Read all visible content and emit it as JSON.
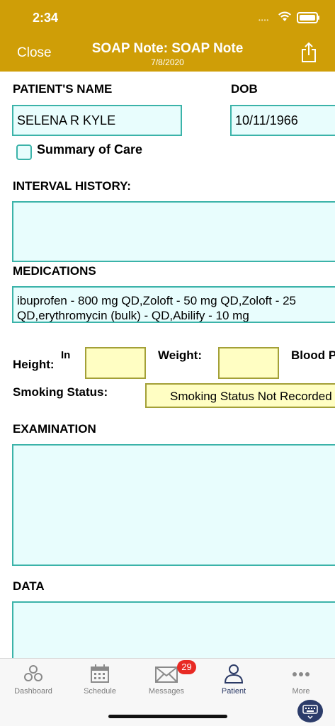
{
  "status_bar": {
    "time": "2:34"
  },
  "header": {
    "close_label": "Close",
    "title": "SOAP Note: SOAP Note",
    "date": "7/8/2020",
    "share_icon": "share-icon"
  },
  "patient": {
    "name_label": "PATIENT'S NAME",
    "name_value": "SELENA R KYLE",
    "dob_label": "DOB",
    "dob_value": "10/11/1966",
    "summary_of_care_label": "Summary of Care",
    "summary_of_care_checked": false
  },
  "interval_history": {
    "label": "INTERVAL HISTORY:",
    "value": ""
  },
  "medications": {
    "label": "MEDICATIONS",
    "line1": "ibuprofen - 800 mg QD,Zoloft - 50 mg QD,Zoloft - 25",
    "line2": "QD,erythromycin (bulk) -  QD,Abilify - 10 mg"
  },
  "vitals": {
    "height_label": "Height:",
    "height_unit": "In",
    "weight_label": "Weight:",
    "blood_label": "Blood P",
    "smoking_label": "Smoking Status:",
    "smoking_value": "Smoking Status Not Recorded"
  },
  "examination": {
    "label": "EXAMINATION",
    "value": ""
  },
  "data_section": {
    "label": "DATA",
    "value": ""
  },
  "tabbar": {
    "tabs": [
      {
        "label": "Dashboard",
        "icon": "dashboard-icon"
      },
      {
        "label": "Schedule",
        "icon": "calendar-icon"
      },
      {
        "label": "Messages",
        "icon": "envelope-icon"
      },
      {
        "label": "Patient",
        "icon": "person-icon"
      },
      {
        "label": "More",
        "icon": "more-icon"
      }
    ],
    "messages_badge": "29",
    "active": "Patient"
  },
  "colors": {
    "header": "#cf9e07",
    "field_border": "#3bb3a9",
    "field_bg": "#e8fdfd",
    "yellow_bg": "#fffec3",
    "active_tab": "#2b3a66",
    "badge": "#e82a24"
  }
}
